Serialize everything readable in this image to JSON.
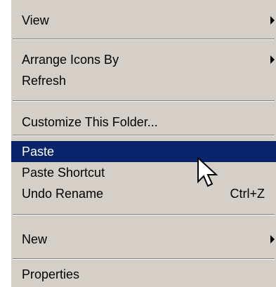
{
  "menu": {
    "view": "View",
    "arrange_icons_by": "Arrange Icons By",
    "refresh": "Refresh",
    "customize_folder": "Customize This Folder...",
    "paste": "Paste",
    "paste_shortcut": "Paste Shortcut",
    "undo_rename": "Undo Rename",
    "undo_rename_shortcut": "Ctrl+Z",
    "new": "New",
    "properties": "Properties"
  },
  "state": {
    "selected_item": "Paste"
  },
  "colors": {
    "menu_background": "#d4d0c8",
    "selection_background": "#0a246a",
    "selection_text": "#ffffff",
    "separator_dark": "#808080",
    "separator_light": "#ffffff"
  },
  "icons": {
    "submenu": "submenu-arrow-icon",
    "cursor": "mouse-pointer-icon"
  }
}
